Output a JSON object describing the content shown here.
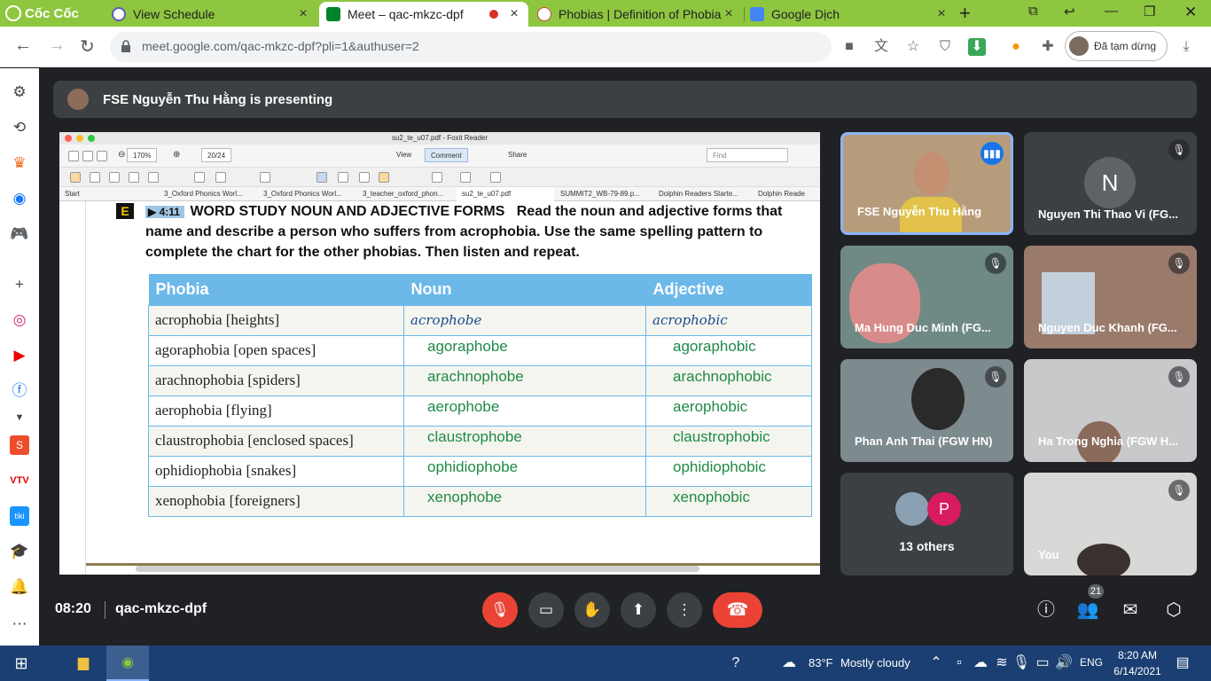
{
  "browser": {
    "logo_text": "Cốc Cốc",
    "tabs": [
      {
        "title": "View Schedule",
        "close": "×"
      },
      {
        "title": "Meet – qac-mkzc-dpf",
        "close": "×"
      },
      {
        "title": "Phobias | Definition of Phobias",
        "close": "×"
      },
      {
        "title": "Google Dịch",
        "close": "×"
      }
    ],
    "new_tab": "+",
    "url": "meet.google.com/qac-mkzc-dpf?pli=1&authuser=2",
    "paused_label": "Đã tạm dừng"
  },
  "meet": {
    "presenter_banner": "FSE Nguyễn Thu Hằng is presenting",
    "time": "08:20",
    "meeting_code": "qac-mkzc-dpf",
    "participant_count": "21",
    "participants": [
      {
        "name": "FSE Nguyễn Thu Hằng",
        "speaking": true
      },
      {
        "name": "Nguyen Thi Thao Vi (FG...",
        "initial": "N",
        "muted": true
      },
      {
        "name": "Ma Hung Duc Minh (FG...",
        "muted": true
      },
      {
        "name": "Nguyen Duc Khanh (FG...",
        "muted": true
      },
      {
        "name": "Phan Anh Thai (FGW HN)",
        "muted": true
      },
      {
        "name": "Ha Trong Nghia (FGW H...",
        "muted": true
      },
      {
        "name": "13 others",
        "initial": "P"
      },
      {
        "name": "You",
        "muted": true
      }
    ]
  },
  "foxit": {
    "window_title": "su2_te_u07.pdf - Foxit Reader",
    "zoom": "170%",
    "page": "20/24",
    "view_label": "View",
    "comment_label": "Comment",
    "share_label": "Share",
    "find_placeholder": "Find",
    "tabs": [
      "Start",
      "3_Oxford Phonics Worl...",
      "3_Oxford Phonics Worl...",
      "3_teacher_oxford_phon...",
      "su2_te_u07.pdf",
      "SUMMIT2_WB-79-89.p...",
      "Dolphin Readers Starte...",
      "Dolphin Reade"
    ]
  },
  "document": {
    "section_letter": "E",
    "track": "4:11",
    "heading_bold": "WORD STUDY   NOUN AND ADJECTIVE FORMS",
    "heading_text": "Read the noun and adjective forms that name and describe a person who suffers from acrophobia. Use the same spelling pattern to complete the chart for the other phobias. Then listen and repeat.",
    "table": {
      "headers": [
        "Phobia",
        "Noun",
        "Adjective"
      ],
      "rows": [
        [
          "acrophobia [heights]",
          "acrophobe",
          "acrophobic"
        ],
        [
          "agoraphobia [open spaces]",
          "agoraphobe",
          "agoraphobic"
        ],
        [
          "arachnophobia [spiders]",
          "arachnophobe",
          "arachnophobic"
        ],
        [
          "aerophobia [flying]",
          "aerophobe",
          "aerophobic"
        ],
        [
          "claustrophobia [enclosed spaces]",
          "claustrophobe",
          "claustrophobic"
        ],
        [
          "ophidiophobia [snakes]",
          "ophidiophobe",
          "ophidiophobic"
        ],
        [
          "xenophobia [foreigners]",
          "xenophobe",
          "xenophobic"
        ]
      ]
    }
  },
  "taskbar": {
    "temperature": "83°F",
    "weather": "Mostly cloudy",
    "language": "ENG",
    "time": "8:20 AM",
    "date": "6/14/2021"
  },
  "colors": {
    "tab_strip": "#8ec63f",
    "end_call": "#ea4335",
    "speaking": "#1a73e8",
    "taskbar": "#1b3f72"
  }
}
